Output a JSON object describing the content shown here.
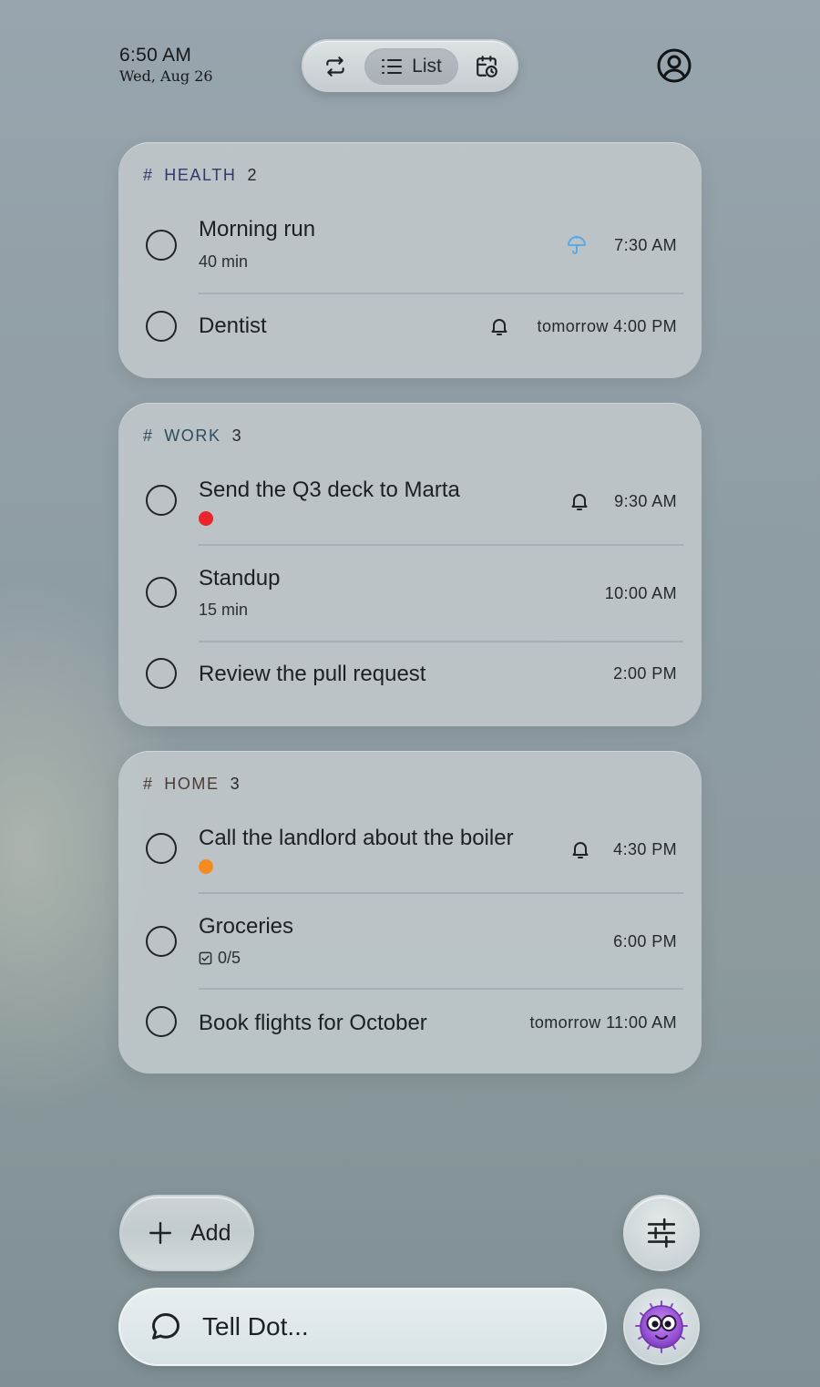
{
  "status": {
    "time": "6:50 AM",
    "date": "Wed, Aug 26"
  },
  "view_switch": {
    "active_label": "List",
    "icons": [
      "repeat-icon",
      "list-icon",
      "calendar-clock-icon"
    ]
  },
  "profile": {
    "icon": "user-circle-icon"
  },
  "groups": [
    {
      "hash": "#",
      "name": "HEALTH",
      "count": "2",
      "accent": "#2f3a6d",
      "tasks": [
        {
          "title": "Morning run",
          "sub": "40 min",
          "icon": "umbrella-icon",
          "icon_color": "#5aa9e6",
          "when": "7:30 AM"
        },
        {
          "title": "Dentist",
          "icon": "bell-icon",
          "when": "tomorrow 4:00 PM"
        }
      ]
    },
    {
      "hash": "#",
      "name": "WORK",
      "count": "3",
      "accent": "#2c4e5e",
      "tasks": [
        {
          "title": "Send the Q3 deck to Marta",
          "priority_color": "#e8262b",
          "icon": "bell-icon",
          "when": "9:30 AM"
        },
        {
          "title": "Standup",
          "sub": "15 min",
          "when": "10:00 AM"
        },
        {
          "title": "Review the pull request",
          "when": "2:00 PM"
        }
      ]
    },
    {
      "hash": "#",
      "name": "HOME",
      "count": "3",
      "accent": "#4b3a35",
      "tasks": [
        {
          "title": "Call the landlord about the boiler",
          "priority_color": "#f58b1f",
          "icon": "bell-icon",
          "when": "4:30 PM"
        },
        {
          "title": "Groceries",
          "sub": "0/5",
          "sub_icon": "checkbox-icon",
          "when": "6:00 PM"
        },
        {
          "title": "Book flights for October",
          "when": "tomorrow 11:00 AM"
        }
      ]
    }
  ],
  "actions": {
    "add_label": "Add",
    "filter_icon": "sliders-icon"
  },
  "assistant": {
    "placeholder": "Tell Dot...",
    "avatar_icon": "dot-monster-avatar"
  }
}
